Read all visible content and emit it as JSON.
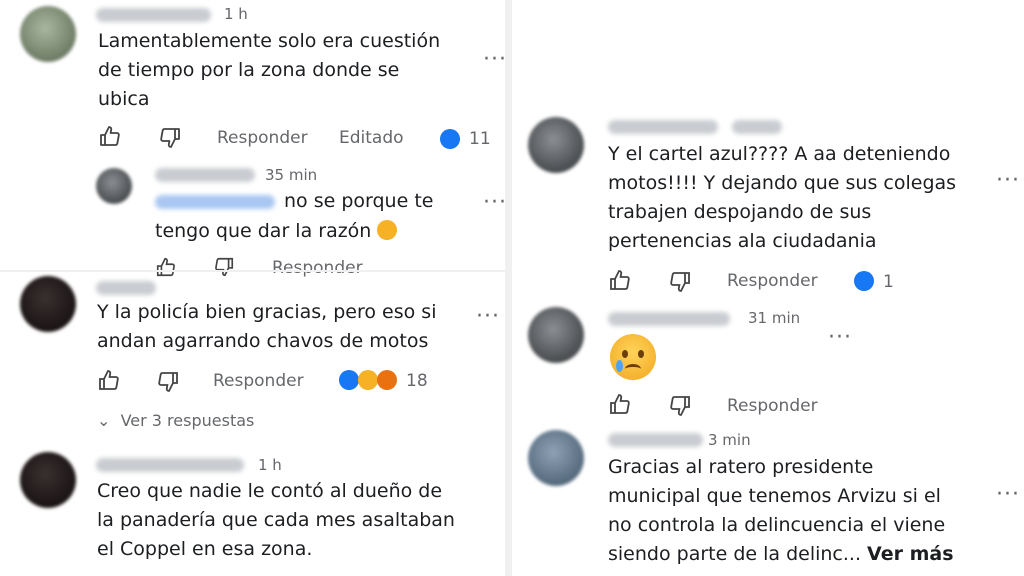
{
  "left_panel": {
    "comment1": {
      "time": "1 h",
      "text_lines": [
        "Lamentablemente solo era cuestión",
        "de tiempo por la zona donde se",
        "ubica"
      ],
      "reply_label": "Responder",
      "edited_label": "Editado",
      "reaction_count": "11"
    },
    "reply1": {
      "time": "35 min",
      "text_line1": "no se porque te",
      "text_line2": "tengo que dar la razón",
      "reply_label": "Responder"
    },
    "comment2": {
      "text_lines": [
        "Y la policía bien gracias, pero eso si",
        "andan agarrando chavos de motos"
      ],
      "reply_label": "Responder",
      "reaction_count": "18",
      "view_replies": "Ver 3 respuestas"
    },
    "comment3": {
      "time": "1 h",
      "text_lines": [
        "Creo que nadie le contó al dueño de",
        "la panadería que cada mes asaltaban",
        "el Coppel en esa zona."
      ]
    }
  },
  "right_panel": {
    "comment4": {
      "text_lines": [
        "Y el cartel azul???? A aa deteniendo",
        "motos!!!! Y dejando que sus colegas",
        "trabajen despojando de sus",
        "pertenencias ala ciudadania"
      ],
      "reply_label": "Responder",
      "reaction_count": "1"
    },
    "comment5": {
      "time": "31 min",
      "emoji": "😢",
      "reply_label": "Responder"
    },
    "comment6": {
      "time": "3 min",
      "text_lines": [
        "Gracias al ratero presidente",
        "municipal que tenemos Arvizu si el",
        "no controla la delincuencia el viene"
      ],
      "text_last": "siendo parte de la delinc...",
      "see_more": "Ver más"
    }
  },
  "colors": {
    "like_blue": "#1877f2",
    "text_gray": "#65676b",
    "link_blue_blurred": "#a9c7f2"
  },
  "icons": [
    "thumbs-up-icon",
    "thumbs-down-icon",
    "like-reaction-icon",
    "haha-reaction-icon",
    "angry-reaction-icon",
    "sad-emoji",
    "more-options-icon",
    "chevron-down-icon"
  ]
}
